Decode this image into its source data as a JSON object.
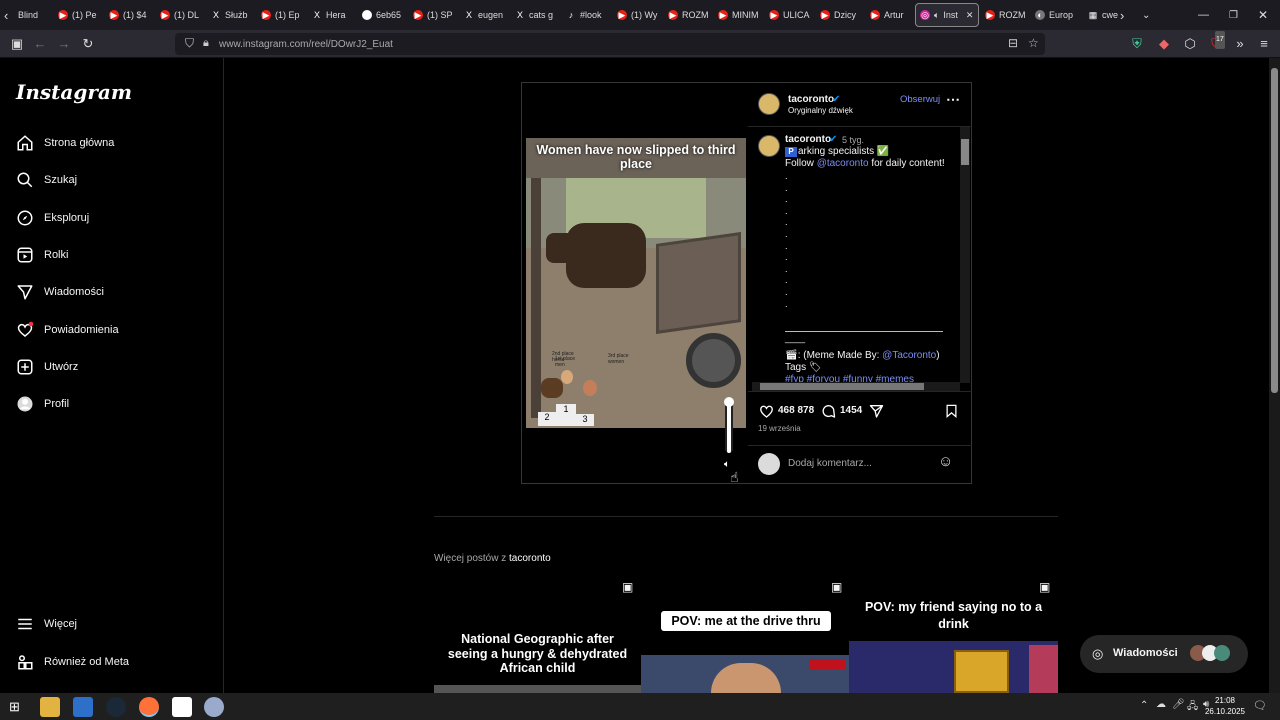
{
  "browser": {
    "tabs": [
      {
        "label": "Blind",
        "icon": "chevron-left-icon"
      },
      {
        "label": "(1) Pe",
        "icon": "youtube-icon"
      },
      {
        "label": "(1) $4",
        "icon": "youtube-icon"
      },
      {
        "label": "(1) DL",
        "icon": "youtube-icon"
      },
      {
        "label": "Służb",
        "icon": "x-icon"
      },
      {
        "label": "(1) Ep",
        "icon": "youtube-icon"
      },
      {
        "label": "Hera",
        "icon": "x-icon"
      },
      {
        "label": "6eb65",
        "icon": "x-square-icon"
      },
      {
        "label": "(1) SP",
        "icon": "youtube-icon"
      },
      {
        "label": "eugen",
        "icon": "x-icon"
      },
      {
        "label": "cats g",
        "icon": "x-icon"
      },
      {
        "label": "#look",
        "icon": "tiktok-icon"
      },
      {
        "label": "(1) Wy",
        "icon": "youtube-icon"
      },
      {
        "label": "ROZM",
        "icon": "youtube-icon"
      },
      {
        "label": "MINIM",
        "icon": "youtube-icon"
      },
      {
        "label": "ULICA",
        "icon": "youtube-icon"
      },
      {
        "label": "Dzicy",
        "icon": "youtube-icon"
      },
      {
        "label": "Artur",
        "icon": "youtube-icon"
      },
      {
        "label": "Inst",
        "icon": "instagram-icon",
        "active": true
      },
      {
        "label": "ROZM",
        "icon": "youtube-icon"
      },
      {
        "label": "Europ",
        "icon": "globe-icon"
      },
      {
        "label": "cwe",
        "icon": "grid-icon"
      }
    ],
    "url": "www.instagram.com/reel/DOwrJ2_Euat"
  },
  "sidebar": {
    "logo": "Instagram",
    "items": [
      {
        "label": "Strona główna",
        "icon": "home-icon"
      },
      {
        "label": "Szukaj",
        "icon": "search-icon"
      },
      {
        "label": "Eksploruj",
        "icon": "compass-icon"
      },
      {
        "label": "Rolki",
        "icon": "reels-icon"
      },
      {
        "label": "Wiadomości",
        "icon": "send-icon"
      },
      {
        "label": "Powiadomienia",
        "icon": "heart-icon"
      },
      {
        "label": "Utwórz",
        "icon": "plus-square-icon"
      },
      {
        "label": "Profil",
        "icon": "avatar-icon"
      }
    ],
    "more": "Więcej",
    "meta": "Również od Meta"
  },
  "post": {
    "video_caption": "Women have now slipped to third place",
    "podium": {
      "first": "1",
      "second": "2",
      "third": "3",
      "label_left": "2nd place horse",
      "label_mid": "1st place men",
      "label_right": "3rd place women"
    },
    "author": "tacoronto",
    "audio": "Oryginalny dźwięk",
    "follow": "Obserwuj",
    "caption_author": "tacoronto",
    "caption_age": "5 tyg.",
    "caption_line1": "arking specialists ✅",
    "caption_line2_pre": "Follow ",
    "caption_mention": "@tacoronto",
    "caption_line2_post": " for daily content!",
    "caption_dots": [
      ".",
      ".",
      ".",
      ".",
      ".",
      ".",
      ".",
      ".",
      ".",
      ".",
      ".",
      "."
    ],
    "caption_sep": "____",
    "meme_credit_pre": ": (Meme Made By: ",
    "meme_credit_mention": "@Tacoronto",
    "meme_credit_post": ")",
    "tags_label": "Tags 🏷",
    "hashtags": "#fyp #foryou #funny #memes",
    "likes": "468 878",
    "comments": "1454",
    "date": "19 września",
    "comment_placeholder": "Dodaj komentarz..."
  },
  "more_posts": {
    "label_pre": "Więcej postów z ",
    "label_user": "tacoronto",
    "thumbs": [
      {
        "title": "National Geographic after seeing a hungry & dehydrated African child"
      },
      {
        "title": "POV: me at the drive thru"
      },
      {
        "title": "POV: my friend saying no to a drink"
      }
    ]
  },
  "messages_button": "Wiadomości",
  "taskbar": {
    "time": "21:08",
    "date": "26.10.2025",
    "extension_badge": "17"
  },
  "colors": {
    "accent": "#0095f6",
    "link": "#7b8ff7",
    "bg": "#000000"
  }
}
